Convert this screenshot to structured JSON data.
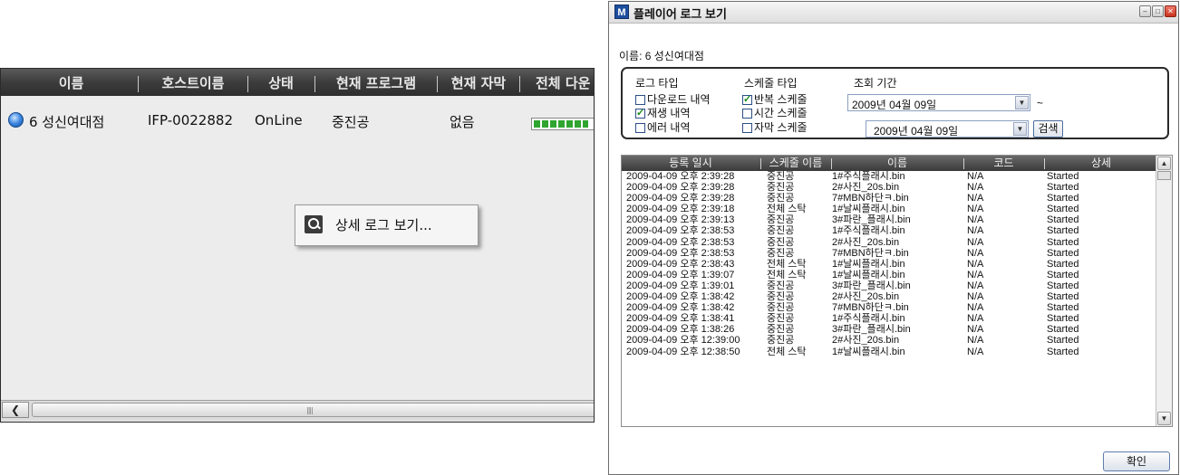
{
  "left_panel": {
    "columns": [
      "이름",
      "호스트이름",
      "상태",
      "현재 프로그램",
      "현재 자막",
      "전체 다운"
    ],
    "row": {
      "name": "6 성신여대점",
      "host": "IFP-0022882",
      "status": "OnLine",
      "program": "중진공",
      "subtitle": "없음",
      "icon": "globe-icon"
    },
    "context_menu": {
      "item": "상세 로그 보기..."
    }
  },
  "dialog": {
    "title": "플레이어 로그 보기",
    "app_icon": "M",
    "site_line": "이름: 6 성신여대점",
    "filters": {
      "log_type_label": "로그 타입",
      "schedule_type_label": "스케줄 타입",
      "period_label": "조회 기간",
      "log_types": [
        {
          "label": "다운로드 내역",
          "checked": false
        },
        {
          "label": "재생 내역",
          "checked": true
        },
        {
          "label": "에러 내역",
          "checked": false
        }
      ],
      "schedule_types": [
        {
          "label": "반복 스케줄",
          "checked": true
        },
        {
          "label": "시간 스케줄",
          "checked": false
        },
        {
          "label": "자막 스케줄",
          "checked": false
        }
      ],
      "date_from": "2009년 04월 09일",
      "date_to": "2009년 04월 09일",
      "tilde": "~",
      "search_label": "검색"
    },
    "table": {
      "headers": [
        "등록 일시",
        "스케줄 이름",
        "이름",
        "코드",
        "상세"
      ],
      "rows": [
        [
          "2009-04-09 오후 2:39:28",
          "중진공",
          "1#주식플래시.bin",
          "N/A",
          "Started"
        ],
        [
          "2009-04-09 오후 2:39:28",
          "중진공",
          "2#사진_20s.bin",
          "N/A",
          "Started"
        ],
        [
          "2009-04-09 오후 2:39:28",
          "중진공",
          "7#MBN하단ㅋ.bin",
          "N/A",
          "Started"
        ],
        [
          "2009-04-09 오후 2:39:18",
          "전체 스탁",
          "1#날씨플래시.bin",
          "N/A",
          "Started"
        ],
        [
          "2009-04-09 오후 2:39:13",
          "중진공",
          "3#파란_플래시.bin",
          "N/A",
          "Started"
        ],
        [
          "2009-04-09 오후 2:38:53",
          "중진공",
          "1#주식플래시.bin",
          "N/A",
          "Started"
        ],
        [
          "2009-04-09 오후 2:38:53",
          "중진공",
          "2#사진_20s.bin",
          "N/A",
          "Started"
        ],
        [
          "2009-04-09 오후 2:38:53",
          "중진공",
          "7#MBN하단ㅋ.bin",
          "N/A",
          "Started"
        ],
        [
          "2009-04-09 오후 2:38:43",
          "전체 스탁",
          "1#날씨플래시.bin",
          "N/A",
          "Started"
        ],
        [
          "2009-04-09 오후 1:39:07",
          "전체 스탁",
          "1#날씨플래시.bin",
          "N/A",
          "Started"
        ],
        [
          "2009-04-09 오후 1:39:01",
          "중진공",
          "3#파란_플래시.bin",
          "N/A",
          "Started"
        ],
        [
          "2009-04-09 오후 1:38:42",
          "중진공",
          "2#사진_20s.bin",
          "N/A",
          "Started"
        ],
        [
          "2009-04-09 오후 1:38:42",
          "중진공",
          "7#MBN하단ㅋ.bin",
          "N/A",
          "Started"
        ],
        [
          "2009-04-09 오후 1:38:41",
          "중진공",
          "1#주식플래시.bin",
          "N/A",
          "Started"
        ],
        [
          "2009-04-09 오후 1:38:26",
          "중진공",
          "3#파란_플래시.bin",
          "N/A",
          "Started"
        ],
        [
          "2009-04-09 오후 12:39:00",
          "중진공",
          "2#사진_20s.bin",
          "N/A",
          "Started"
        ],
        [
          "2009-04-09 오후 12:38:50",
          "전체 스탁",
          "1#날씨플래시.bin",
          "N/A",
          "Started"
        ]
      ]
    },
    "ok_label": "확인"
  }
}
